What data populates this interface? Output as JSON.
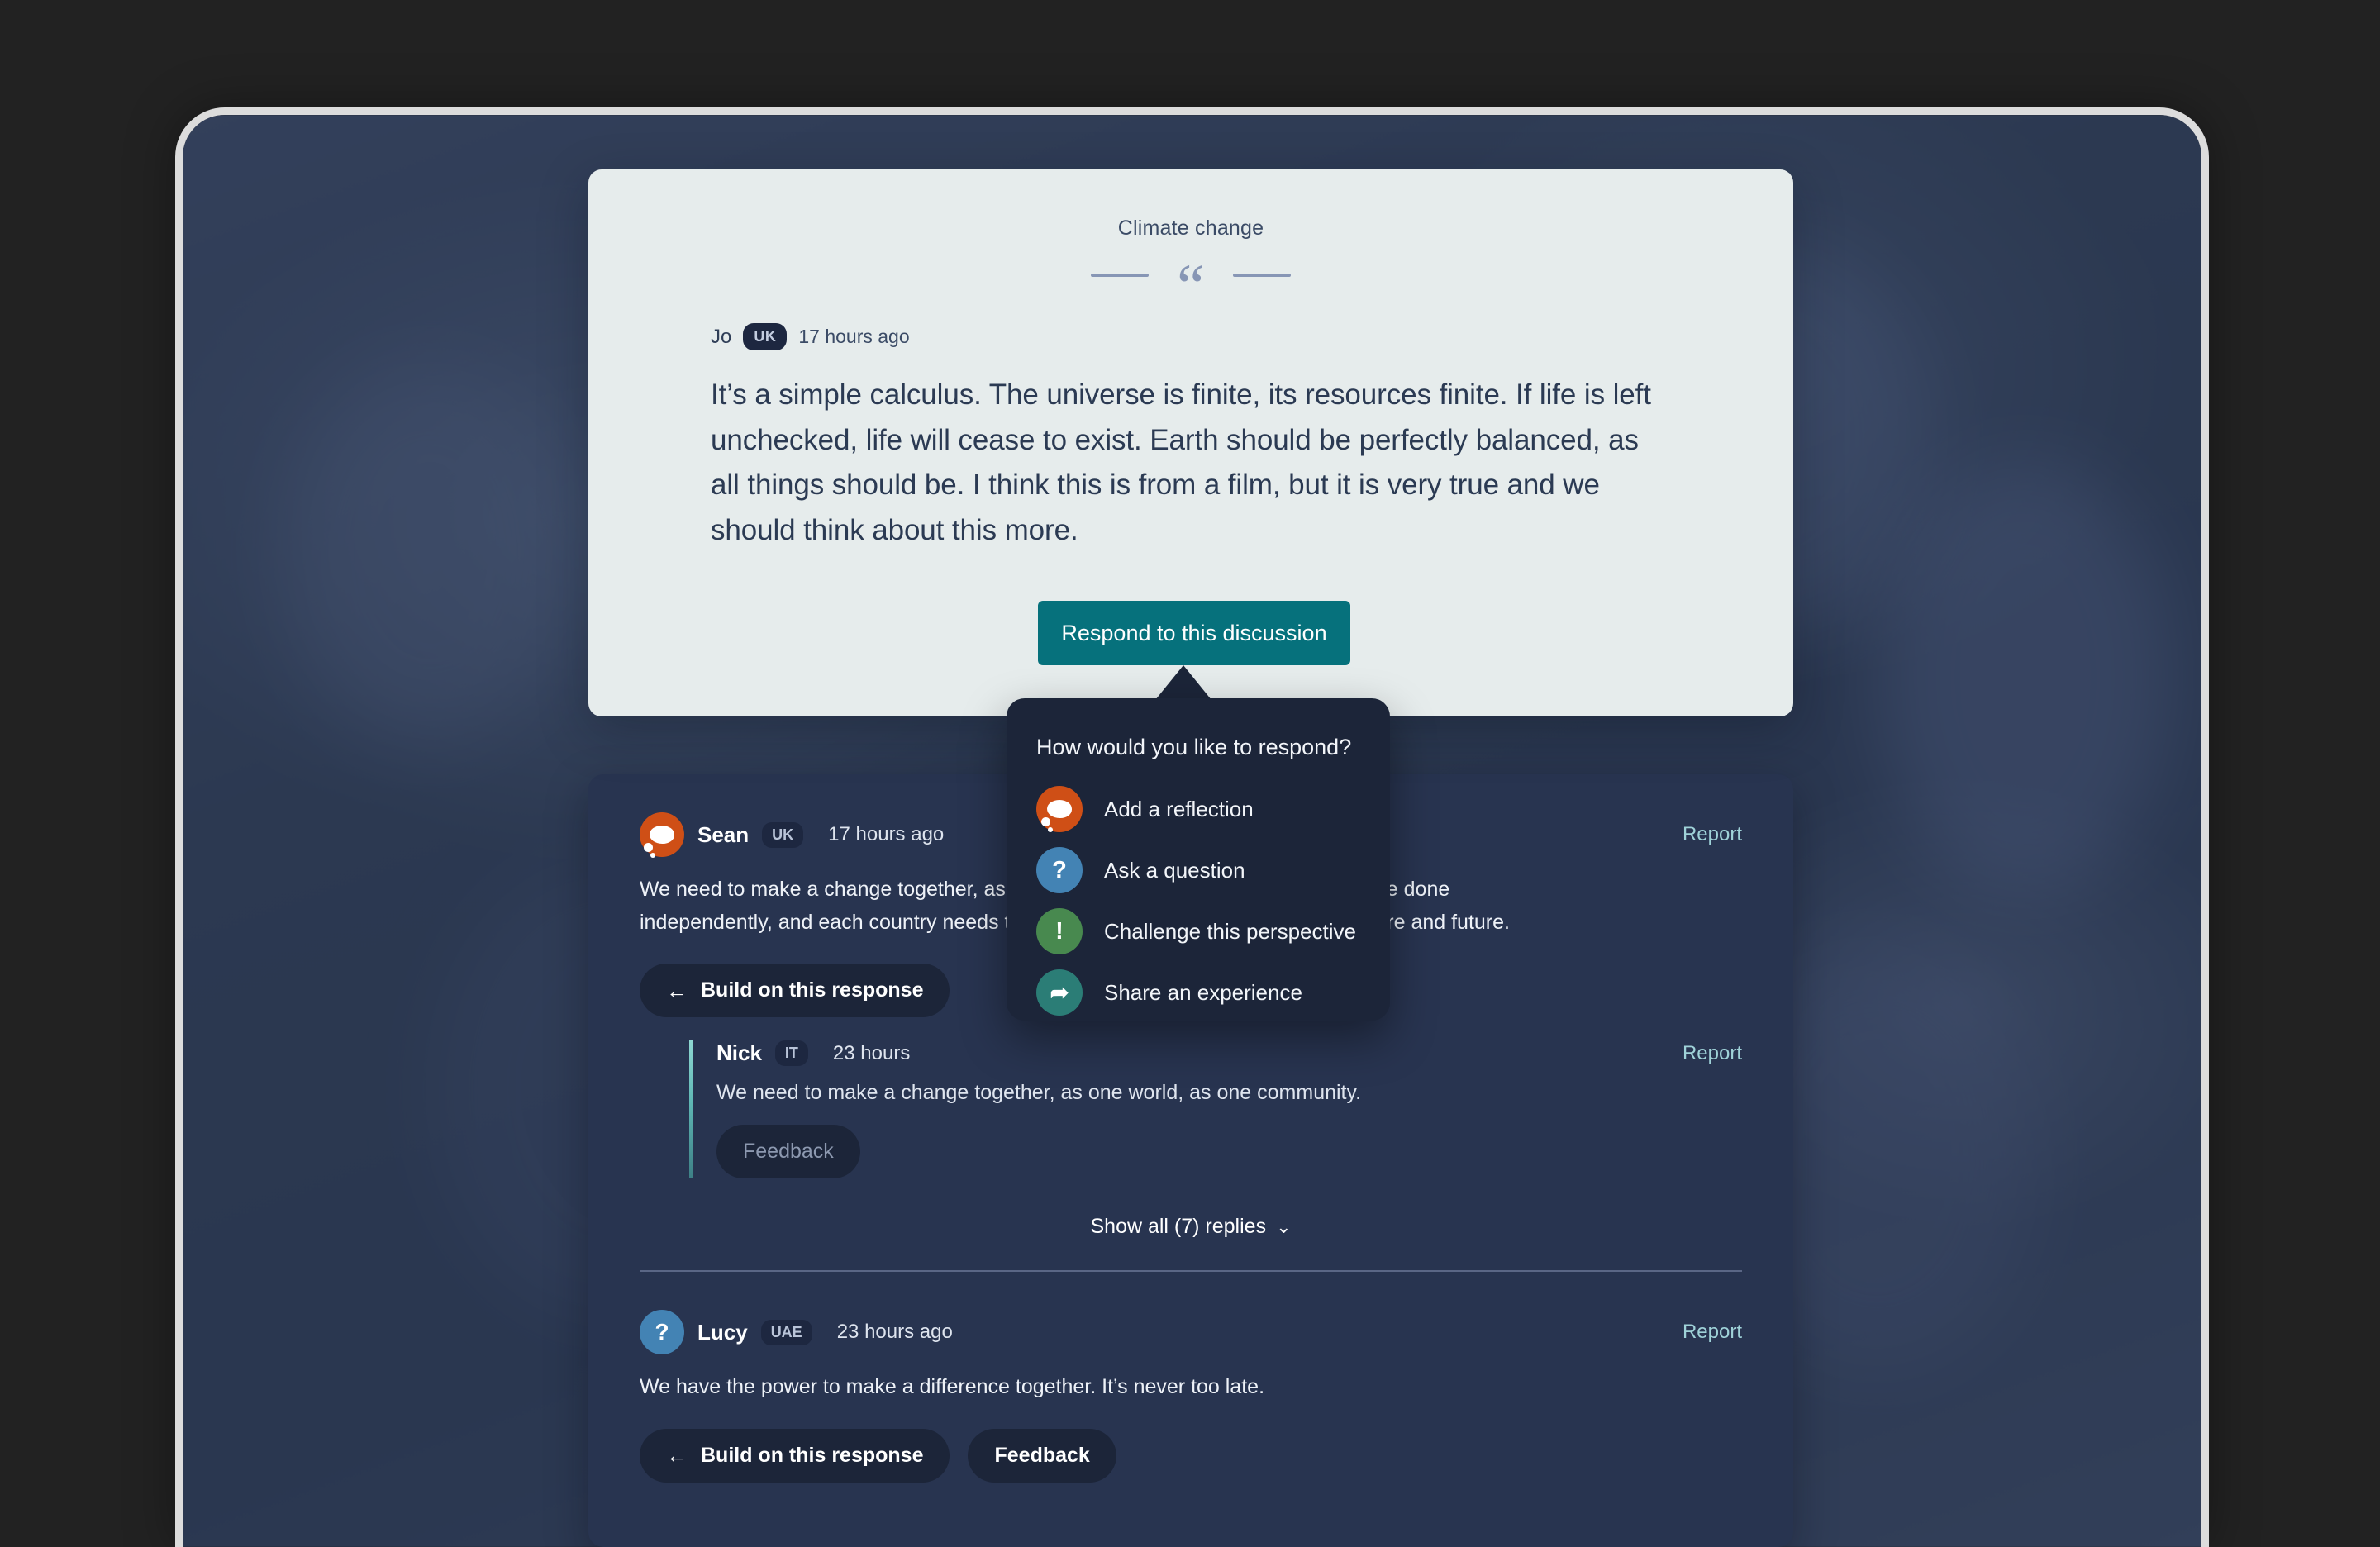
{
  "quote_card": {
    "topic": "Climate change",
    "quote_glyph": "“",
    "author": "Jo",
    "author_flag": "UK",
    "timestamp": "17 hours ago",
    "body": "It’s a simple calculus. The universe is finite, its resources finite. If life is left unchecked, life will cease to exist. Earth should be perfectly balanced, as all things should be. I think this is from a film, but it is very true and we should think about this more."
  },
  "respond": {
    "button_label": "Respond to this discussion",
    "button_color": "#06717c",
    "popup_title": "How would you like to respond?",
    "options": [
      {
        "label": "Add a reflection",
        "icon": "thought-bubble-icon",
        "color": "#cf4f16"
      },
      {
        "label": "Ask a question",
        "icon": "question-mark-icon",
        "glyph": "?",
        "color": "#4383b4"
      },
      {
        "label": "Challenge this perspective",
        "icon": "exclamation-icon",
        "glyph": "!",
        "color": "#48894f"
      },
      {
        "label": "Share an experience",
        "icon": "share-arrow-icon",
        "glyph": "➦",
        "color": "#2b7d76"
      }
    ]
  },
  "responses": [
    {
      "name": "Sean",
      "flag": "UK",
      "timestamp": "17 hours ago",
      "avatar_icon": "thought-bubble-icon",
      "avatar_color": "#cf4f16",
      "body": "We need to make a change together, as one world, as one community. It cannot be done independently, and each country needs to see itself as part of a much bigger picture and future.",
      "report_label": "Report",
      "actions": [
        {
          "label": "Build on this response",
          "icon": "arrow-left-icon",
          "muted": false
        }
      ],
      "reply": {
        "name": "Nick",
        "flag": "IT",
        "timestamp": "23 hours",
        "body": "We need to make a change together, as one world, as one community.",
        "report_label": "Report",
        "actions": [
          {
            "label": "Feedback",
            "muted": true
          }
        ]
      },
      "show_replies_label": "Show all (7) replies",
      "show_replies_chevron": "⌄"
    },
    {
      "name": "Lucy",
      "flag": "UAE",
      "timestamp": "23 hours ago",
      "avatar_icon": "question-mark-icon",
      "avatar_glyph": "?",
      "avatar_color": "#4383b4",
      "body": "We have the power to make a difference together. It’s never too late.",
      "report_label": "Report",
      "actions": [
        {
          "label": "Build on this response",
          "icon": "arrow-left-icon",
          "muted": false
        },
        {
          "label": "Feedback",
          "muted": false
        }
      ]
    }
  ],
  "icons": {
    "arrow_left": "←",
    "chevron_down": "⌄"
  }
}
